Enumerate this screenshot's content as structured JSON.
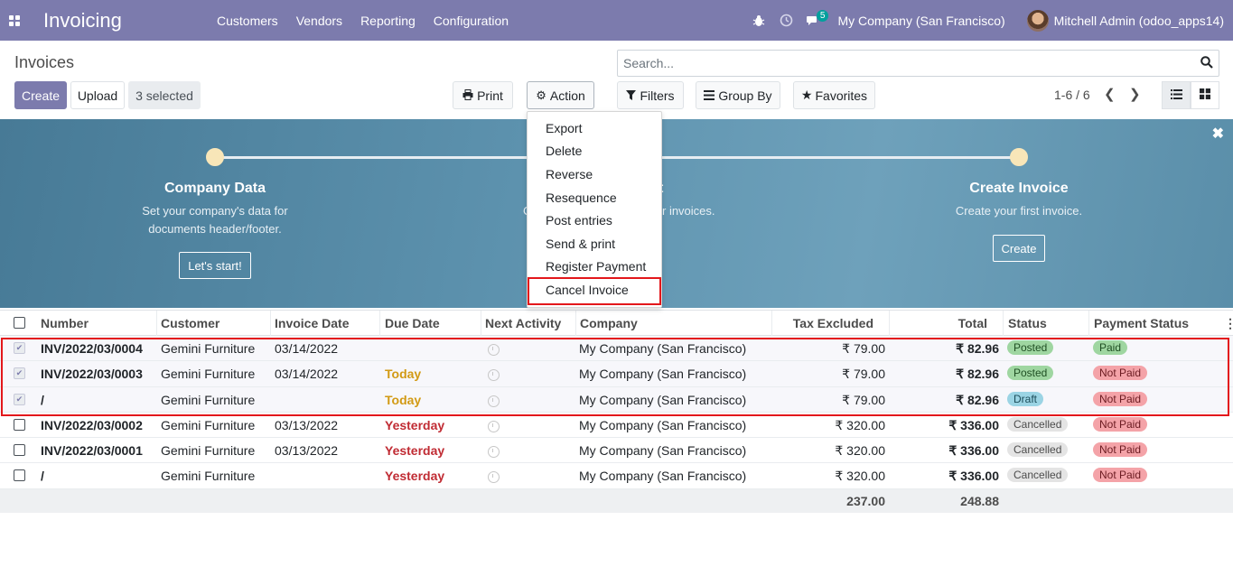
{
  "navbar": {
    "app_name": "Invoicing",
    "menu": [
      "Customers",
      "Vendors",
      "Reporting",
      "Configuration"
    ],
    "message_count": "5",
    "company": "My Company (San Francisco)",
    "user": "Mitchell Admin (odoo_apps14)",
    "bg_color": "#7c7bad"
  },
  "control_panel": {
    "title": "Invoices",
    "create_label": "Create",
    "upload_label": "Upload",
    "selected_label": "3 selected",
    "print_label": "Print",
    "action_label": "Action",
    "search_placeholder": "Search...",
    "filters_label": "Filters",
    "groupby_label": "Group By",
    "favorites_label": "Favorites",
    "pager": "1-6 / 6"
  },
  "action_menu": {
    "items": [
      "Export",
      "Delete",
      "Reverse",
      "Resequence",
      "Post entries",
      "Send & print",
      "Register Payment",
      "Cancel Invoice"
    ],
    "highlighted": "Cancel Invoice"
  },
  "banner": {
    "step1": {
      "title": "Company Data",
      "desc1": "Set your company's data for",
      "desc2": "documents header/footer.",
      "button": "Let's start!"
    },
    "step2": {
      "title_fragment": "t",
      "desc_prefix": "C",
      "desc_suffix": "r invoices."
    },
    "step3": {
      "title": "Create Invoice",
      "desc": "Create your first invoice.",
      "button": "Create"
    }
  },
  "table": {
    "columns": [
      "Number",
      "Customer",
      "Invoice Date",
      "Due Date",
      "Next Activity",
      "Company",
      "Tax Excluded",
      "Total",
      "Status",
      "Payment Status"
    ],
    "rows": [
      {
        "number": "INV/2022/03/0004",
        "customer": "Gemini Furniture",
        "invoice_date": "03/14/2022",
        "due_date": "",
        "company": "My Company (San Francisco)",
        "tax_excluded": "₹ 79.00",
        "total": "₹ 82.96",
        "status": "Posted",
        "payment": "Paid"
      },
      {
        "number": "INV/2022/03/0003",
        "customer": "Gemini Furniture",
        "invoice_date": "03/14/2022",
        "due_date": "Today",
        "company": "My Company (San Francisco)",
        "tax_excluded": "₹ 79.00",
        "total": "₹ 82.96",
        "status": "Posted",
        "payment": "Not Paid"
      },
      {
        "number": "/",
        "customer": "Gemini Furniture",
        "invoice_date": "",
        "due_date": "Today",
        "company": "My Company (San Francisco)",
        "tax_excluded": "₹ 79.00",
        "total": "₹ 82.96",
        "status": "Draft",
        "payment": "Not Paid"
      },
      {
        "number": "INV/2022/03/0002",
        "customer": "Gemini Furniture",
        "invoice_date": "03/13/2022",
        "due_date": "Yesterday",
        "company": "My Company (San Francisco)",
        "tax_excluded": "₹ 320.00",
        "total": "₹ 336.00",
        "status": "Cancelled",
        "payment": "Not Paid"
      },
      {
        "number": "INV/2022/03/0001",
        "customer": "Gemini Furniture",
        "invoice_date": "03/13/2022",
        "due_date": "Yesterday",
        "company": "My Company (San Francisco)",
        "tax_excluded": "₹ 320.00",
        "total": "₹ 336.00",
        "status": "Cancelled",
        "payment": "Not Paid"
      },
      {
        "number": "/",
        "customer": "Gemini Furniture",
        "invoice_date": "",
        "due_date": "Yesterday",
        "company": "My Company (San Francisco)",
        "tax_excluded": "₹ 320.00",
        "total": "₹ 336.00",
        "status": "Cancelled",
        "payment": "Not Paid"
      }
    ],
    "totals": {
      "tax_excluded": "237.00",
      "total": "248.88"
    }
  }
}
